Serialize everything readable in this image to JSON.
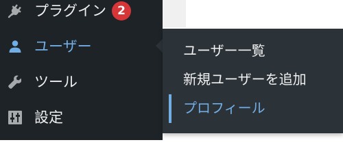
{
  "colors": {
    "sidebar_bg": "#1d2327",
    "flyout_bg": "#2c3338",
    "accent": "#72aee6",
    "badge_bg": "#d63638",
    "text": "#f0f0f1",
    "icon": "#a7aaad"
  },
  "sidebar": {
    "items": [
      {
        "label": "プラグイン",
        "icon": "plugin-icon",
        "badge": "2",
        "current": false
      },
      {
        "label": "ユーザー",
        "icon": "user-icon",
        "current": true
      },
      {
        "label": "ツール",
        "icon": "wrench-icon",
        "current": false
      },
      {
        "label": "設定",
        "icon": "settings-sliders-icon",
        "current": false
      }
    ]
  },
  "flyout": {
    "items": [
      {
        "label": "ユーザー一覧",
        "current": false
      },
      {
        "label": "新規ユーザーを追加",
        "current": false
      },
      {
        "label": "プロフィール",
        "current": true
      }
    ]
  }
}
